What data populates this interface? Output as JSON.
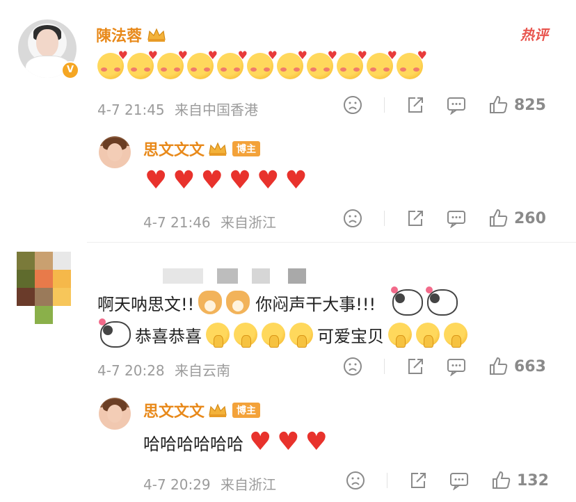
{
  "comment1": {
    "username": "陳法蓉",
    "hot_tag": "热评",
    "emoji_count": 11,
    "time": "4-7 21:45",
    "location": "来自中国香港",
    "likes": "825"
  },
  "reply1": {
    "username": "思文文文",
    "badge": "博主",
    "hearts": 6,
    "time": "4-7 21:46",
    "location": "来自浙江",
    "likes": "260"
  },
  "comment2": {
    "line1_text_a": "啊天呐思文!!",
    "line1_text_b": "你闷声干大事!!!",
    "line2_text_a": "恭喜恭喜",
    "line2_text_b": "可爱宝贝",
    "time": "4-7 20:28",
    "location": "来自云南",
    "likes": "663"
  },
  "reply2": {
    "username": "思文文文",
    "badge": "博主",
    "text": "哈哈哈哈哈哈",
    "hearts": 3,
    "time": "4-7 20:29",
    "location": "来自浙江",
    "likes": "132"
  },
  "colors": {
    "username": "#e8891a",
    "hot": "#e8554e",
    "heart": "#e8322c",
    "meta": "#9b9b9b"
  },
  "icons": [
    "sad-face-icon",
    "share-icon",
    "comment-icon",
    "thumbs-up-icon",
    "crown-icon",
    "verified-icon"
  ]
}
